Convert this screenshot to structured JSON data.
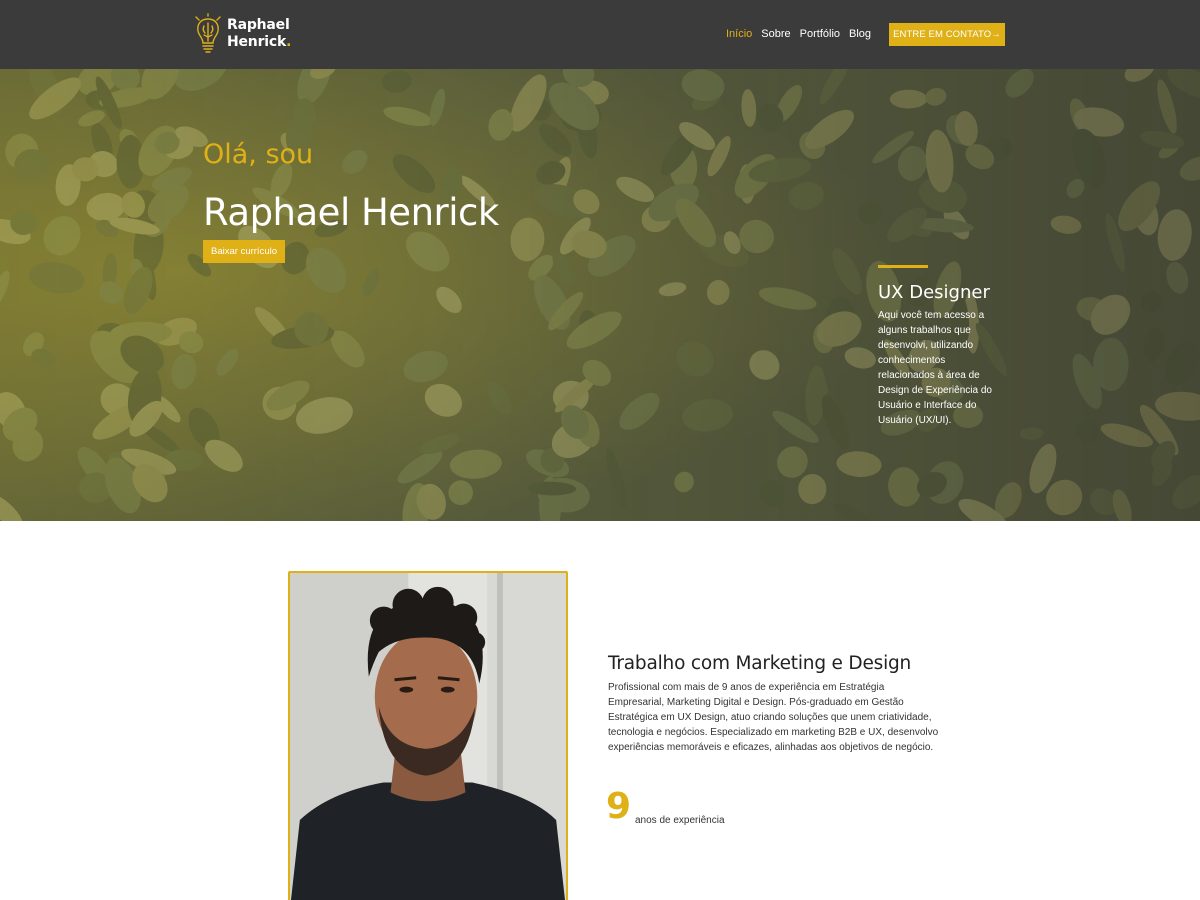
{
  "header": {
    "logo": {
      "line1": "Raphael",
      "line2": "Henrick",
      "dot": ".",
      "icon": "lightbulb-brain-icon"
    },
    "nav": [
      {
        "label": "Início",
        "active": true
      },
      {
        "label": "Sobre",
        "active": false
      },
      {
        "label": "Portfólio",
        "active": false
      },
      {
        "label": "Blog",
        "active": false
      }
    ],
    "cta_label": "ENTRE EM CONTATO→"
  },
  "hero": {
    "greeting": "Olá, sou",
    "name": "Raphael Henrick",
    "button_label": "Baixar currículo",
    "role_title": "UX Designer",
    "role_description": "Aqui você tem acesso a alguns trabalhos que desenvolvi, utilizando conhecimentos relacionados à área de Design de Experiência do Usuário e Interface do Usuário (UX/UI)."
  },
  "about": {
    "title": "Trabalho com Marketing e Design",
    "text": "Profissional com mais de 9 anos de experiência em Estratégia Empresarial, Marketing Digital e Design. Pós-graduado em Gestão Estratégica em UX Design, atuo criando soluções que unem criatividade, tecnologia e negócios. Especializado em marketing B2B e UX, desenvolvo experiências memoráveis e eficazes, alinhadas aos objetivos de negócio.",
    "experience_number": "9",
    "experience_label": "anos de experiência"
  },
  "colors": {
    "accent": "#e0b017",
    "header_bg": "#3b3b3b",
    "text_dark": "#222222"
  }
}
